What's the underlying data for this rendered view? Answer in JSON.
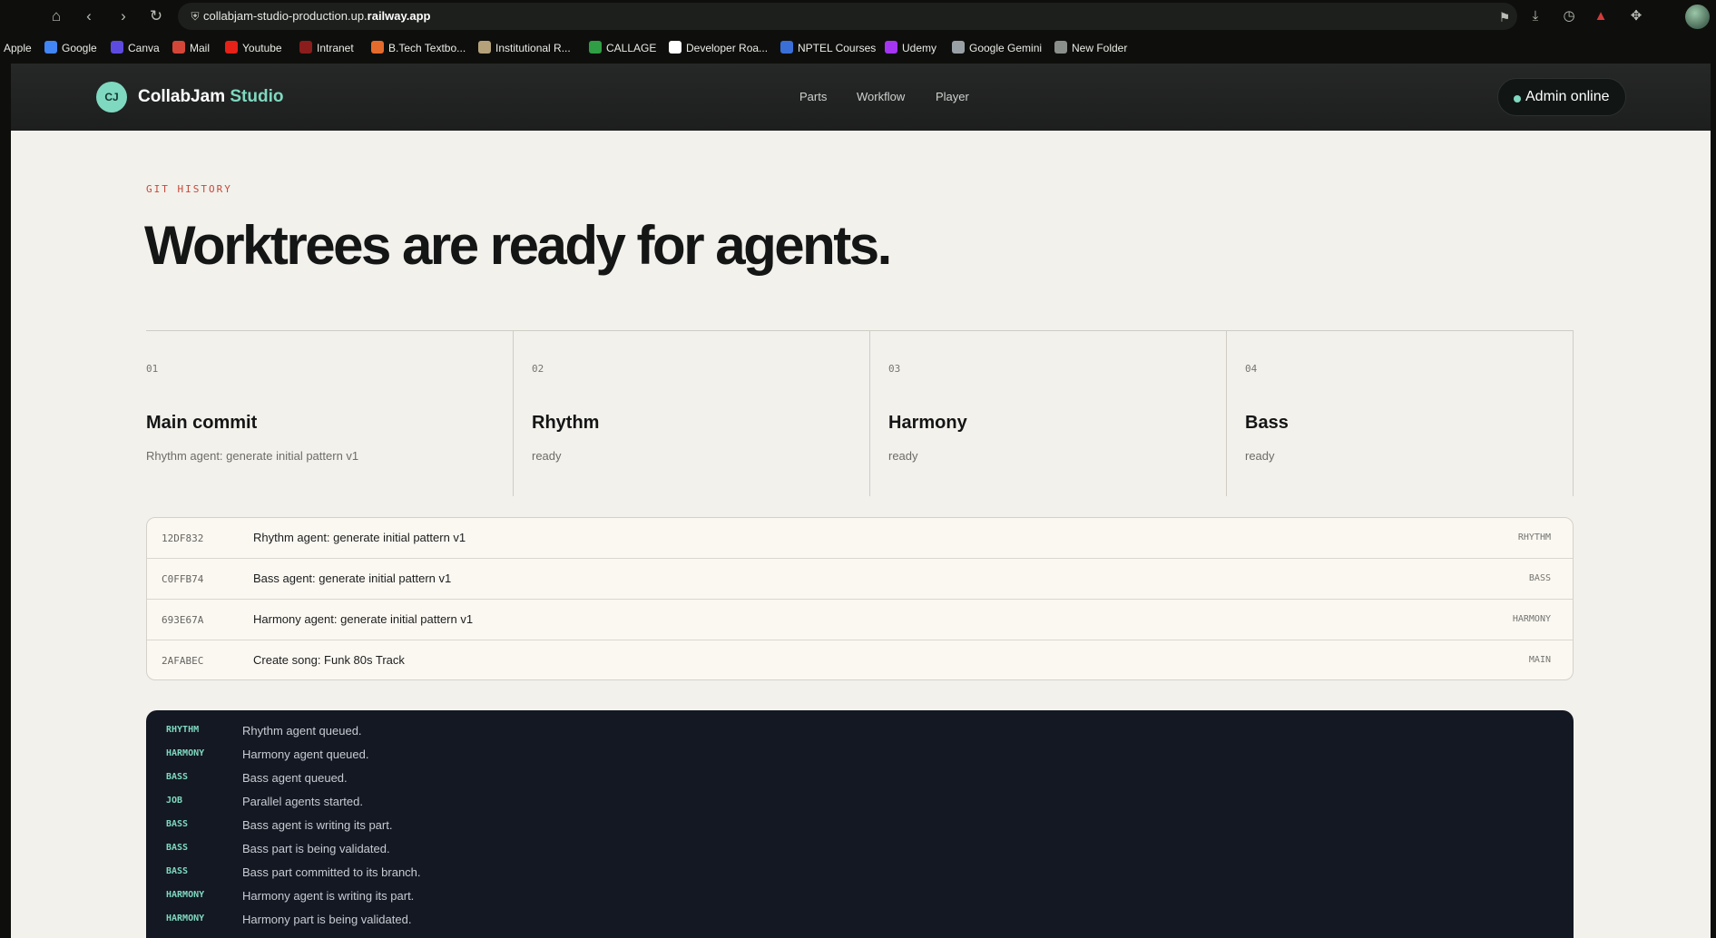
{
  "browser": {
    "url_host": "collabjam-studio-production.up.",
    "url_domain": "railway.app",
    "bookmarks": [
      {
        "label": "Apple",
        "icon": "apple-icon",
        "color": "#0e0f0c"
      },
      {
        "label": "Google",
        "icon": "google-icon",
        "color": "#4285f4"
      },
      {
        "label": "Canva",
        "icon": "canva-icon",
        "color": "#5d4be0"
      },
      {
        "label": "Mail",
        "icon": "gmail-icon",
        "color": "#d44638"
      },
      {
        "label": "Youtube",
        "icon": "youtube-icon",
        "color": "#e62117"
      },
      {
        "label": "Intranet",
        "icon": "intranet-icon",
        "color": "#8b1d1d"
      },
      {
        "label": "B.Tech Textbo...",
        "icon": "textbook-icon",
        "color": "#e56b2c"
      },
      {
        "label": "Institutional R...",
        "icon": "repository-icon",
        "color": "#b5a27a"
      },
      {
        "label": "CALLAGE",
        "icon": "drive-icon",
        "color": "#2f9e44"
      },
      {
        "label": "Developer Roa...",
        "icon": "roadmap-icon",
        "color": "#ffffff"
      },
      {
        "label": "NPTEL Courses",
        "icon": "nptel-icon",
        "color": "#3a6fd8"
      },
      {
        "label": "Udemy",
        "icon": "udemy-icon",
        "color": "#a435f0"
      },
      {
        "label": "Google Gemini",
        "icon": "gemini-icon",
        "color": "#9aa1a6"
      },
      {
        "label": "New Folder",
        "icon": "folder-icon",
        "color": "#8a8f8b"
      }
    ]
  },
  "header": {
    "logo_initials": "CJ",
    "brand_primary": "CollabJam",
    "brand_accent": "Studio",
    "nav": [
      "Parts",
      "Workflow",
      "Player"
    ],
    "status": "Admin online",
    "accent_color": "#7fd8c0"
  },
  "hero": {
    "eyebrow": "GIT HISTORY",
    "title": "Worktrees are ready for agents."
  },
  "branches": [
    {
      "num": "01",
      "name": "Main commit",
      "detail": "Rhythm agent: generate initial pattern v1"
    },
    {
      "num": "02",
      "name": "Rhythm",
      "detail": "ready"
    },
    {
      "num": "03",
      "name": "Harmony",
      "detail": "ready"
    },
    {
      "num": "04",
      "name": "Bass",
      "detail": "ready"
    }
  ],
  "commits": [
    {
      "hash": "12DF832",
      "message": "Rhythm agent: generate initial pattern v1",
      "branch": "RHYTHM"
    },
    {
      "hash": "C0FFB74",
      "message": "Bass agent: generate initial pattern v1",
      "branch": "BASS"
    },
    {
      "hash": "693E67A",
      "message": "Harmony agent: generate initial pattern v1",
      "branch": "HARMONY"
    },
    {
      "hash": "2AFABEC",
      "message": "Create song: Funk 80s Track",
      "branch": "MAIN"
    }
  ],
  "log": [
    {
      "tag": "RHYTHM",
      "message": "Rhythm agent queued."
    },
    {
      "tag": "HARMONY",
      "message": "Harmony agent queued."
    },
    {
      "tag": "BASS",
      "message": "Bass agent queued."
    },
    {
      "tag": "JOB",
      "message": "Parallel agents started."
    },
    {
      "tag": "BASS",
      "message": "Bass agent is writing its part."
    },
    {
      "tag": "BASS",
      "message": "Bass part is being validated."
    },
    {
      "tag": "BASS",
      "message": "Bass part committed to its branch."
    },
    {
      "tag": "HARMONY",
      "message": "Harmony agent is writing its part."
    },
    {
      "tag": "HARMONY",
      "message": "Harmony part is being validated."
    }
  ]
}
